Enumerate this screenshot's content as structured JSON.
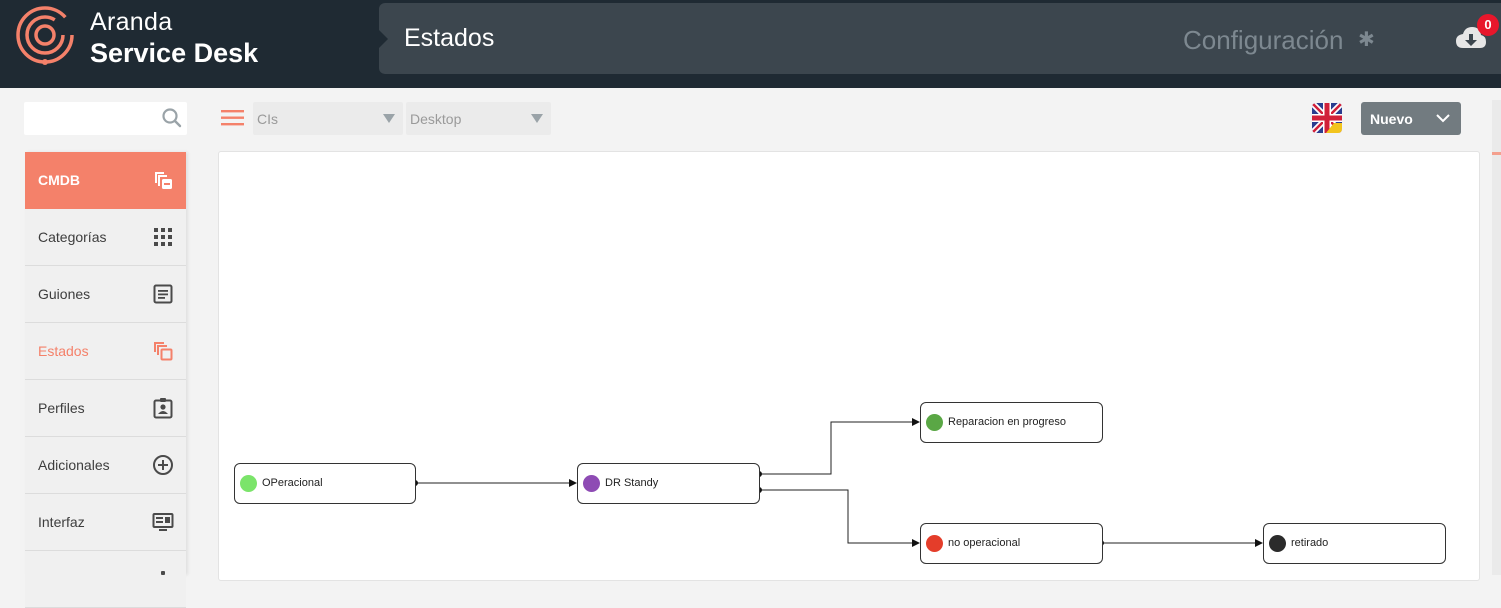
{
  "brand": {
    "line1": "Aranda",
    "line2": "Service Desk"
  },
  "header": {
    "title": "Estados",
    "config_label": "Configuración",
    "notification_count": "0"
  },
  "sidebar": {
    "items": [
      {
        "label": "CMDB",
        "icon": "copy-remove-icon"
      },
      {
        "label": "Categorías",
        "icon": "grid-icon"
      },
      {
        "label": "Guiones",
        "icon": "document-icon"
      },
      {
        "label": "Estados",
        "icon": "copy-icon"
      },
      {
        "label": "Perfiles",
        "icon": "badge-icon"
      },
      {
        "label": "Adicionales",
        "icon": "plus-circle-icon"
      },
      {
        "label": "Interfaz",
        "icon": "monitor-icon"
      }
    ]
  },
  "toolbar": {
    "select1_value": "CIs",
    "select2_value": "Desktop",
    "new_label": "Nuevo"
  },
  "flow": {
    "nodes": [
      {
        "id": "operacional",
        "label": "OPeracional",
        "color": "#7be46a"
      },
      {
        "id": "dr-standy",
        "label": "DR Standy",
        "color": "#8e4bb4"
      },
      {
        "id": "reparacion",
        "label": "Reparacion en progreso",
        "color": "#5aa745"
      },
      {
        "id": "no-operacional",
        "label": "no operacional",
        "color": "#e43d2a"
      },
      {
        "id": "retirado",
        "label": "retirado",
        "color": "#2b2b2b"
      }
    ]
  },
  "colors": {
    "accent": "#f4816a",
    "header_bg": "#1f2a33",
    "title_bar_bg": "#3c464e"
  }
}
